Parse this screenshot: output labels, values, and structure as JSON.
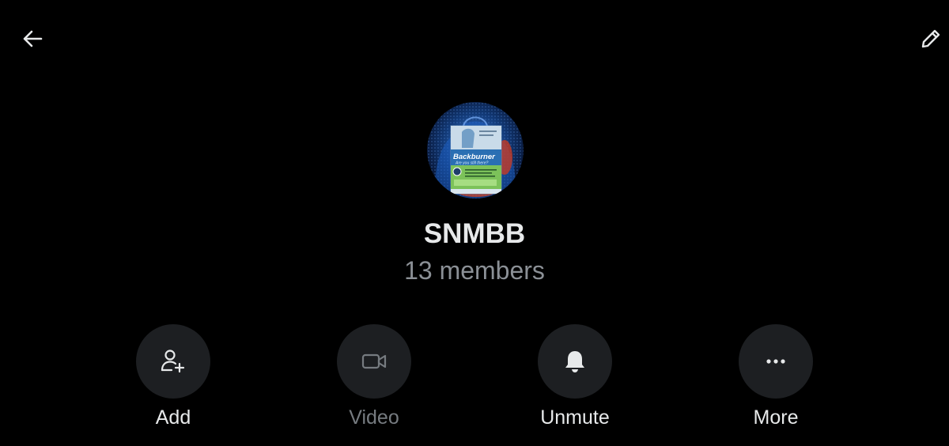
{
  "header": {
    "back_icon": "arrow-left-icon",
    "edit_icon": "pencil-icon"
  },
  "group": {
    "name": "SNMBB",
    "members": "13 members",
    "avatar": {
      "brand": "Backburner",
      "tagline": "Are you still there?"
    }
  },
  "actions": [
    {
      "label": "Add",
      "icon": "add-person-icon",
      "enabled": true
    },
    {
      "label": "Video",
      "icon": "video-camera-icon",
      "enabled": false
    },
    {
      "label": "Unmute",
      "icon": "bell-icon",
      "enabled": true
    },
    {
      "label": "More",
      "icon": "more-dots-icon",
      "enabled": true
    }
  ],
  "colors": {
    "background": "#000000",
    "text": "#e7e9ea",
    "muted": "#8b9096",
    "disabled": "#767b80",
    "button_bg": "#1d1f22"
  }
}
